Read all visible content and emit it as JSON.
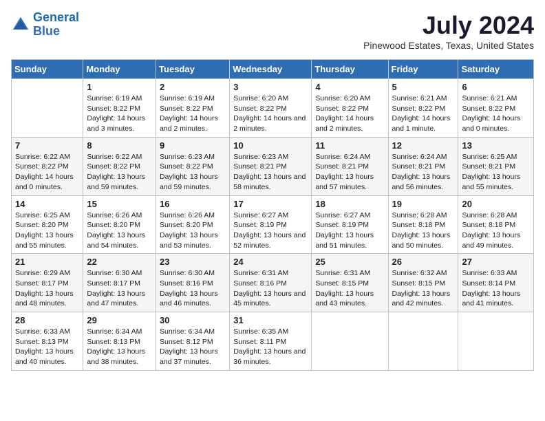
{
  "logo": {
    "line1": "General",
    "line2": "Blue"
  },
  "title": "July 2024",
  "location": "Pinewood Estates, Texas, United States",
  "days_of_week": [
    "Sunday",
    "Monday",
    "Tuesday",
    "Wednesday",
    "Thursday",
    "Friday",
    "Saturday"
  ],
  "weeks": [
    [
      {
        "day": "",
        "sunrise": "",
        "sunset": "",
        "daylight": ""
      },
      {
        "day": "1",
        "sunrise": "Sunrise: 6:19 AM",
        "sunset": "Sunset: 8:22 PM",
        "daylight": "Daylight: 14 hours and 3 minutes."
      },
      {
        "day": "2",
        "sunrise": "Sunrise: 6:19 AM",
        "sunset": "Sunset: 8:22 PM",
        "daylight": "Daylight: 14 hours and 2 minutes."
      },
      {
        "day": "3",
        "sunrise": "Sunrise: 6:20 AM",
        "sunset": "Sunset: 8:22 PM",
        "daylight": "Daylight: 14 hours and 2 minutes."
      },
      {
        "day": "4",
        "sunrise": "Sunrise: 6:20 AM",
        "sunset": "Sunset: 8:22 PM",
        "daylight": "Daylight: 14 hours and 2 minutes."
      },
      {
        "day": "5",
        "sunrise": "Sunrise: 6:21 AM",
        "sunset": "Sunset: 8:22 PM",
        "daylight": "Daylight: 14 hours and 1 minute."
      },
      {
        "day": "6",
        "sunrise": "Sunrise: 6:21 AM",
        "sunset": "Sunset: 8:22 PM",
        "daylight": "Daylight: 14 hours and 0 minutes."
      }
    ],
    [
      {
        "day": "7",
        "sunrise": "Sunrise: 6:22 AM",
        "sunset": "Sunset: 8:22 PM",
        "daylight": "Daylight: 14 hours and 0 minutes."
      },
      {
        "day": "8",
        "sunrise": "Sunrise: 6:22 AM",
        "sunset": "Sunset: 8:22 PM",
        "daylight": "Daylight: 13 hours and 59 minutes."
      },
      {
        "day": "9",
        "sunrise": "Sunrise: 6:23 AM",
        "sunset": "Sunset: 8:22 PM",
        "daylight": "Daylight: 13 hours and 59 minutes."
      },
      {
        "day": "10",
        "sunrise": "Sunrise: 6:23 AM",
        "sunset": "Sunset: 8:21 PM",
        "daylight": "Daylight: 13 hours and 58 minutes."
      },
      {
        "day": "11",
        "sunrise": "Sunrise: 6:24 AM",
        "sunset": "Sunset: 8:21 PM",
        "daylight": "Daylight: 13 hours and 57 minutes."
      },
      {
        "day": "12",
        "sunrise": "Sunrise: 6:24 AM",
        "sunset": "Sunset: 8:21 PM",
        "daylight": "Daylight: 13 hours and 56 minutes."
      },
      {
        "day": "13",
        "sunrise": "Sunrise: 6:25 AM",
        "sunset": "Sunset: 8:21 PM",
        "daylight": "Daylight: 13 hours and 55 minutes."
      }
    ],
    [
      {
        "day": "14",
        "sunrise": "Sunrise: 6:25 AM",
        "sunset": "Sunset: 8:20 PM",
        "daylight": "Daylight: 13 hours and 55 minutes."
      },
      {
        "day": "15",
        "sunrise": "Sunrise: 6:26 AM",
        "sunset": "Sunset: 8:20 PM",
        "daylight": "Daylight: 13 hours and 54 minutes."
      },
      {
        "day": "16",
        "sunrise": "Sunrise: 6:26 AM",
        "sunset": "Sunset: 8:20 PM",
        "daylight": "Daylight: 13 hours and 53 minutes."
      },
      {
        "day": "17",
        "sunrise": "Sunrise: 6:27 AM",
        "sunset": "Sunset: 8:19 PM",
        "daylight": "Daylight: 13 hours and 52 minutes."
      },
      {
        "day": "18",
        "sunrise": "Sunrise: 6:27 AM",
        "sunset": "Sunset: 8:19 PM",
        "daylight": "Daylight: 13 hours and 51 minutes."
      },
      {
        "day": "19",
        "sunrise": "Sunrise: 6:28 AM",
        "sunset": "Sunset: 8:18 PM",
        "daylight": "Daylight: 13 hours and 50 minutes."
      },
      {
        "day": "20",
        "sunrise": "Sunrise: 6:28 AM",
        "sunset": "Sunset: 8:18 PM",
        "daylight": "Daylight: 13 hours and 49 minutes."
      }
    ],
    [
      {
        "day": "21",
        "sunrise": "Sunrise: 6:29 AM",
        "sunset": "Sunset: 8:17 PM",
        "daylight": "Daylight: 13 hours and 48 minutes."
      },
      {
        "day": "22",
        "sunrise": "Sunrise: 6:30 AM",
        "sunset": "Sunset: 8:17 PM",
        "daylight": "Daylight: 13 hours and 47 minutes."
      },
      {
        "day": "23",
        "sunrise": "Sunrise: 6:30 AM",
        "sunset": "Sunset: 8:16 PM",
        "daylight": "Daylight: 13 hours and 46 minutes."
      },
      {
        "day": "24",
        "sunrise": "Sunrise: 6:31 AM",
        "sunset": "Sunset: 8:16 PM",
        "daylight": "Daylight: 13 hours and 45 minutes."
      },
      {
        "day": "25",
        "sunrise": "Sunrise: 6:31 AM",
        "sunset": "Sunset: 8:15 PM",
        "daylight": "Daylight: 13 hours and 43 minutes."
      },
      {
        "day": "26",
        "sunrise": "Sunrise: 6:32 AM",
        "sunset": "Sunset: 8:15 PM",
        "daylight": "Daylight: 13 hours and 42 minutes."
      },
      {
        "day": "27",
        "sunrise": "Sunrise: 6:33 AM",
        "sunset": "Sunset: 8:14 PM",
        "daylight": "Daylight: 13 hours and 41 minutes."
      }
    ],
    [
      {
        "day": "28",
        "sunrise": "Sunrise: 6:33 AM",
        "sunset": "Sunset: 8:13 PM",
        "daylight": "Daylight: 13 hours and 40 minutes."
      },
      {
        "day": "29",
        "sunrise": "Sunrise: 6:34 AM",
        "sunset": "Sunset: 8:13 PM",
        "daylight": "Daylight: 13 hours and 38 minutes."
      },
      {
        "day": "30",
        "sunrise": "Sunrise: 6:34 AM",
        "sunset": "Sunset: 8:12 PM",
        "daylight": "Daylight: 13 hours and 37 minutes."
      },
      {
        "day": "31",
        "sunrise": "Sunrise: 6:35 AM",
        "sunset": "Sunset: 8:11 PM",
        "daylight": "Daylight: 13 hours and 36 minutes."
      },
      {
        "day": "",
        "sunrise": "",
        "sunset": "",
        "daylight": ""
      },
      {
        "day": "",
        "sunrise": "",
        "sunset": "",
        "daylight": ""
      },
      {
        "day": "",
        "sunrise": "",
        "sunset": "",
        "daylight": ""
      }
    ]
  ]
}
